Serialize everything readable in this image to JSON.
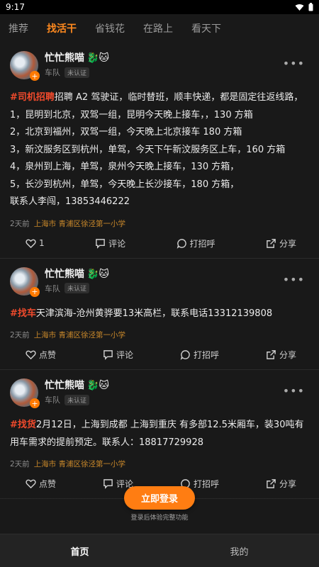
{
  "status": {
    "time": "9:17"
  },
  "tabs": [
    "推荐",
    "找活干",
    "省钱花",
    "在路上",
    "看天下"
  ],
  "active_tab": 1,
  "posts": [
    {
      "name": "忙忙熊喵",
      "emoji": "🐉🐱",
      "team": "车队",
      "cert": "未认证",
      "tag": "#司机招聘",
      "content": "招聘 A2 驾驶证，临时替班，顺丰快递，都是固定往返线路，\n1，昆明到北京，双驾一组，昆明今天晚上接车，，130 方箱\n2，北京到福州，双驾一组，今天晚上北京接车 180 方箱\n3，新汶服务区到杭州，单驾，今天下午新汶服务区上车，160 方箱\n4，泉州到上海，单驾，泉州今天晚上接车，130 方箱，\n5，长沙到杭州，单驾，今天晚上长沙接车，180 方箱，\n联系人李闯，13853446222",
      "time": "2天前",
      "location": "上海市 青浦区徐泾第一小学",
      "like": "1",
      "comment": "评论",
      "call": "打招呼",
      "share": "分享"
    },
    {
      "name": "忙忙熊喵",
      "emoji": "🐉🐱",
      "team": "车队",
      "cert": "未认证",
      "tag": "#找车",
      "content": "天津滨海-沧州黄骅要13米高栏，联系电话13312139808",
      "time": "2天前",
      "location": "上海市 青浦区徐泾第一小学",
      "like": "点赞",
      "comment": "评论",
      "call": "打招呼",
      "share": "分享"
    },
    {
      "name": "忙忙熊喵",
      "emoji": "🐉🐱",
      "team": "车队",
      "cert": "未认证",
      "tag": "#找货",
      "content": "2月12日，上海到成都  上海到重庆  有多部12.5米厢车，装30吨有用车需求的提前预定。联系人：18817729928",
      "time": "2天前",
      "location": "上海市 青浦区徐泾第一小学",
      "like": "点赞",
      "comment": "评论",
      "call": "打招呼",
      "share": "分享"
    }
  ],
  "login": {
    "button": "立即登录",
    "tip": "登录后体验完整功能"
  },
  "bottom_nav": [
    "首页",
    "我的"
  ],
  "colors": {
    "accent": "#ff7d12",
    "tag": "#f04a2c",
    "location": "#c9882a"
  }
}
